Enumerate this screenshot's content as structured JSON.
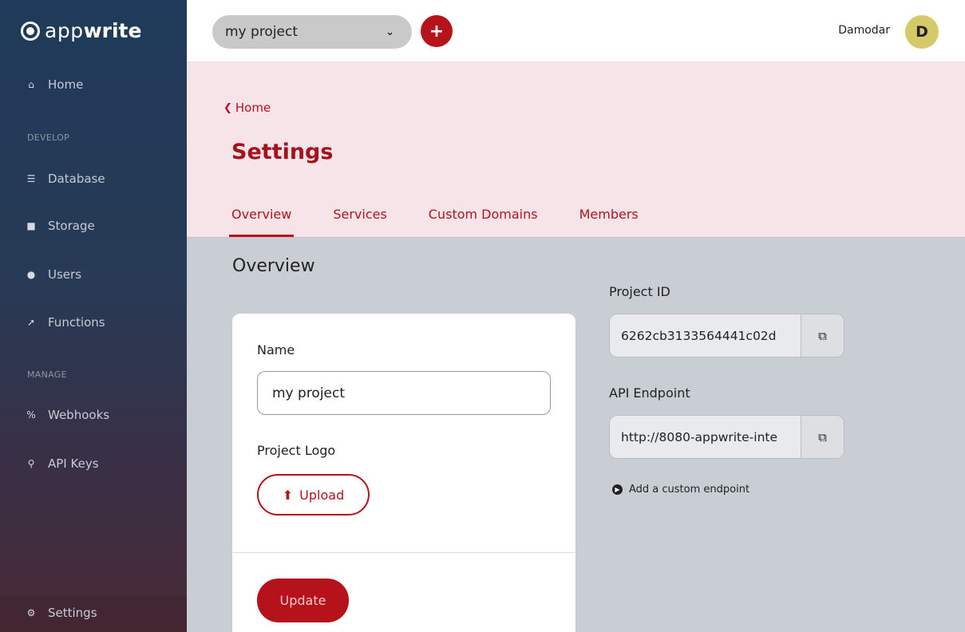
{
  "brand": {
    "name_light": "app",
    "name_bold": "write"
  },
  "sidebar": {
    "home": {
      "label": "Home",
      "icon": "home-icon"
    },
    "section_develop": "DEVELOP",
    "database": {
      "label": "Database",
      "icon": "database-icon"
    },
    "storage": {
      "label": "Storage",
      "icon": "folder-icon"
    },
    "users": {
      "label": "Users",
      "icon": "users-icon"
    },
    "functions": {
      "label": "Functions",
      "icon": "bolt-icon"
    },
    "section_manage": "MANAGE",
    "webhooks": {
      "label": "Webhooks",
      "icon": "link-icon"
    },
    "api_keys": {
      "label": "API Keys",
      "icon": "key-icon"
    },
    "settings": {
      "label": "Settings",
      "icon": "gear-icon"
    }
  },
  "topbar": {
    "project_name": "my project",
    "add_label": "+",
    "user_name": "Damodar",
    "avatar_initial": "D"
  },
  "header": {
    "back_label": "Home",
    "title": "Settings",
    "tabs": [
      "Overview",
      "Services",
      "Custom Domains",
      "Members"
    ],
    "active_tab": "Overview"
  },
  "main": {
    "section_title": "Overview",
    "name_label": "Name",
    "name_value": "my project",
    "logo_label": "Project Logo",
    "upload_label": "Upload",
    "update_label": "Update",
    "project_id_label": "Project ID",
    "project_id_value": "6262cb3133564441c02d",
    "api_endpoint_label": "API Endpoint",
    "api_endpoint_value": "http://8080-appwrite-inte",
    "custom_endpoint_label": "Add a custom endpoint"
  },
  "colors": {
    "accent": "#b5121b",
    "header_bg": "#f6e4e9",
    "content_bg": "#c9ced5",
    "avatar_bg": "#d6c96a"
  }
}
